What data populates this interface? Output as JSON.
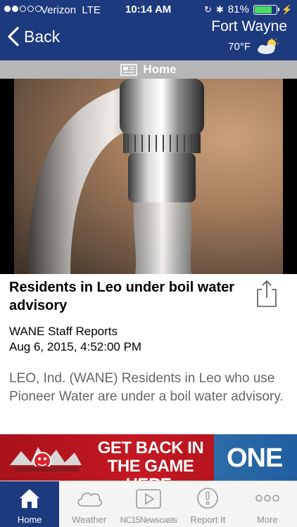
{
  "status_bar": {
    "carrier": "Verizon",
    "network": "LTE",
    "time": "10:14 AM",
    "battery_percent": "81%",
    "battery_level": 0.81
  },
  "nav": {
    "back_label": "Back",
    "city": "Fort Wayne",
    "temperature": "70°F",
    "weather_icon": "partly-cloudy-icon"
  },
  "section": {
    "title": "Home",
    "icon": "newspaper-icon"
  },
  "article": {
    "headline": "Residents in Leo under boil water advisory",
    "author": "WANE Staff Reports",
    "date": "Aug 6, 2015, 4:52:00 PM",
    "body": "LEO, Ind. (WANE) Residents in Leo who use Pioneer Water are under a boil water advisory."
  },
  "ad": {
    "headline": "GET BACK IN THE GAME HERE.",
    "brand": "ONE",
    "colors": {
      "red": "#c41822",
      "blue": "#2d6ca8"
    }
  },
  "tabbar": {
    "tabs": [
      {
        "label": "Home",
        "icon": "home-icon",
        "active": true
      },
      {
        "label": "Weather",
        "icon": "cloud-icon",
        "active": false
      },
      {
        "label": "NC15Newscasts",
        "icon": "play-icon",
        "active": false
      },
      {
        "label": "Report It",
        "icon": "alert-icon",
        "active": false
      },
      {
        "label": "More",
        "icon": "more-icon",
        "active": false
      }
    ]
  },
  "colors": {
    "navy": "#1e3a7e",
    "section_gray": "#b6b6b6",
    "battery_green": "#4cd964"
  }
}
